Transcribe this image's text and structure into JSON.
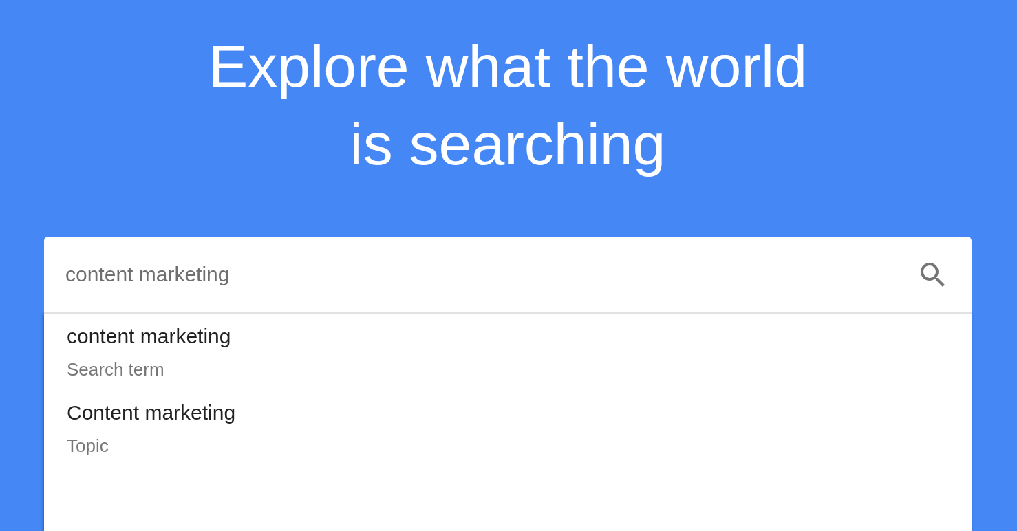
{
  "heading": "Explore what the world is searching",
  "search": {
    "value": "content marketing"
  },
  "suggestions": [
    {
      "term": "content marketing",
      "type": "Search term",
      "selected": false
    },
    {
      "term": "Content marketing",
      "type": "Topic",
      "selected": false
    }
  ]
}
